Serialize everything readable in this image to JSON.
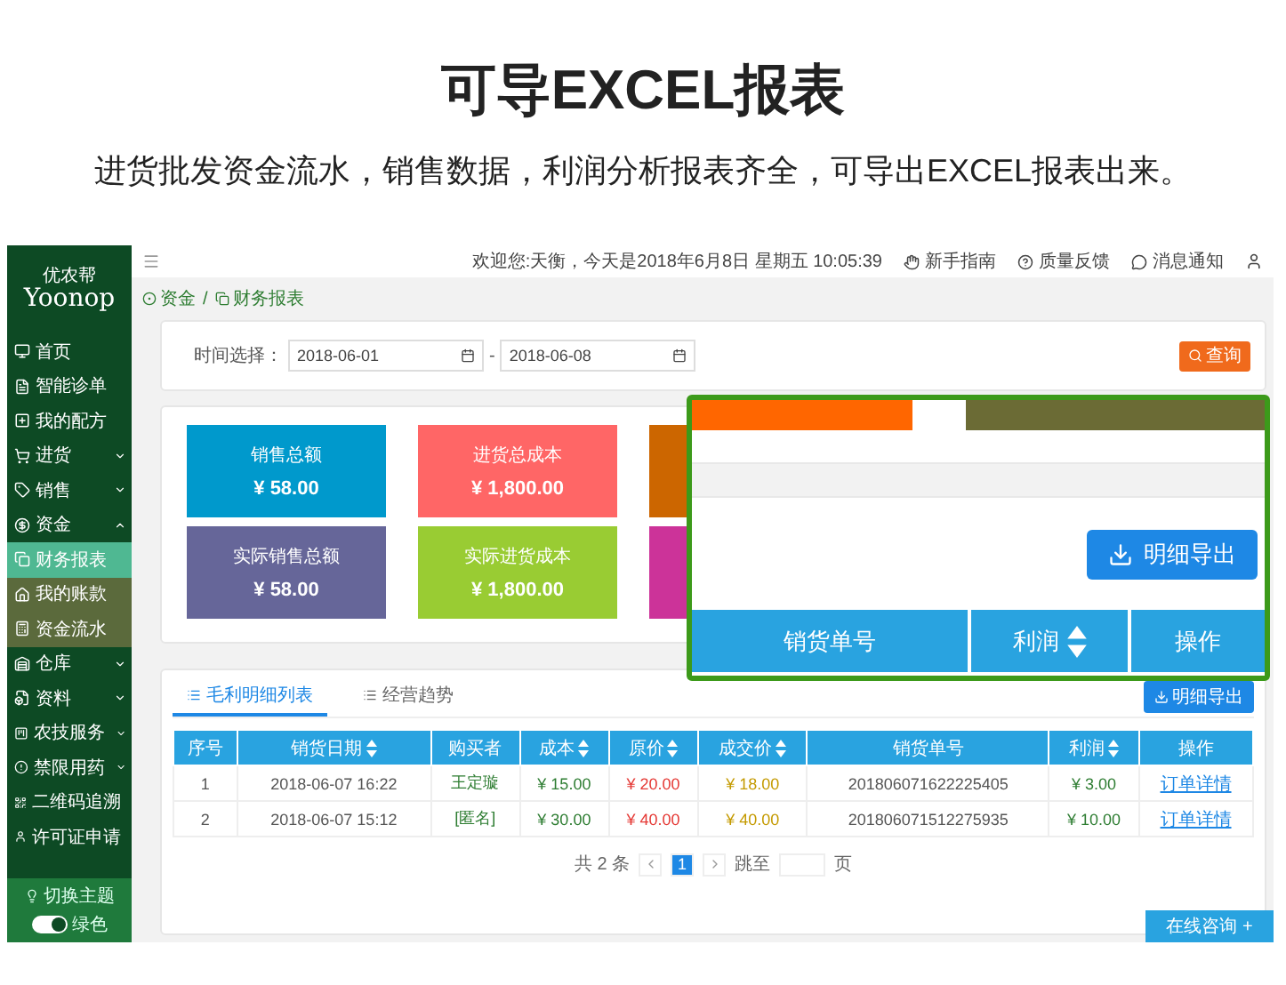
{
  "heading": {
    "title": "可导EXCEL报表",
    "subtitle": "进货批发资金流水，销售数据，利润分析报表齐全，可导出EXCEL报表出来。"
  },
  "app": {
    "logo": {
      "brand_cn": "优农帮",
      "brand": "Yoonop"
    },
    "sidebar": {
      "items": [
        {
          "label": "首页",
          "kind": "link"
        },
        {
          "label": "智能诊单",
          "kind": "link"
        },
        {
          "label": "我的配方",
          "kind": "link"
        },
        {
          "label": "进货",
          "kind": "group",
          "expanded": false
        },
        {
          "label": "销售",
          "kind": "group",
          "expanded": false
        },
        {
          "label": "资金",
          "kind": "group",
          "expanded": true,
          "children": [
            {
              "label": "财务报表",
              "selected": true
            },
            {
              "label": "我的账款",
              "selected": false
            },
            {
              "label": "资金流水",
              "selected": false
            }
          ]
        },
        {
          "label": "仓库",
          "kind": "group",
          "expanded": false
        },
        {
          "label": "资料",
          "kind": "group",
          "expanded": false
        },
        {
          "label": "农技服务",
          "kind": "group",
          "expanded": false
        },
        {
          "label": "禁限用药",
          "kind": "group",
          "expanded": false
        },
        {
          "label": "二维码追溯",
          "kind": "link"
        },
        {
          "label": "许可证申请",
          "kind": "link"
        }
      ]
    },
    "theme_switch": {
      "label": "切换主题",
      "on": true,
      "value": "绿色"
    },
    "topbar": {
      "greeting": "欢迎您:天衡，今天是2018年6月8日 星期五 10:05:39",
      "links": [
        "新手指南",
        "质量反馈",
        "消息通知"
      ]
    },
    "breadcrumb": {
      "items": [
        "资金",
        "财务报表"
      ],
      "separator": "/"
    },
    "filter": {
      "label": "时间选择：",
      "start": "2018-06-01",
      "separator": "-",
      "end": "2018-06-08",
      "button": "查询"
    },
    "summary_cards": [
      {
        "label": "销售总额",
        "value": "¥ 58.00",
        "color": "#0099cc"
      },
      {
        "label": "进货总成本",
        "value": "¥ 1,800.00",
        "color": "#ff6666"
      },
      {
        "color": "#cc6600"
      },
      {
        "label": "实际销售总额",
        "value": "¥ 58.00",
        "color": "#666699"
      },
      {
        "label": "实际进货成本",
        "value": "¥ 1,800.00",
        "color": "#99cc33"
      },
      {
        "color": "#cc3399"
      }
    ],
    "tabs": [
      {
        "label": "毛利明细列表",
        "selected": true
      },
      {
        "label": "经营趋势",
        "selected": false
      }
    ],
    "export_button": "明细导出",
    "table": {
      "columns": [
        {
          "label": "序号",
          "sortable": false,
          "kind": "text"
        },
        {
          "label": "销货日期",
          "sortable": true,
          "kind": "text"
        },
        {
          "label": "购买者",
          "sortable": false,
          "kind": "buyer"
        },
        {
          "label": "成本",
          "sortable": true,
          "kind": "money",
          "color": "#2e7d32"
        },
        {
          "label": "原价",
          "sortable": true,
          "kind": "money",
          "color": "#e53935"
        },
        {
          "label": "成交价",
          "sortable": true,
          "kind": "money",
          "color": "#c49a00"
        },
        {
          "label": "销货单号",
          "sortable": false,
          "kind": "text"
        },
        {
          "label": "利润",
          "sortable": true,
          "kind": "money",
          "color": "#2e7d32"
        },
        {
          "label": "操作",
          "sortable": false,
          "kind": "link"
        }
      ],
      "rows": [
        [
          "1",
          "2018-06-07 16:22",
          "王定璇",
          "¥ 15.00",
          "¥ 20.00",
          "¥ 18.00",
          "201806071622225405",
          "¥ 3.00",
          "订单详情"
        ],
        [
          "2",
          "2018-06-07 15:12",
          "[匿名]",
          "¥ 30.00",
          "¥ 40.00",
          "¥ 40.00",
          "201806071512275935",
          "¥ 10.00",
          "订单详情"
        ]
      ]
    },
    "pagination": {
      "total": "共 2 条",
      "pages": [
        {
          "label": "1",
          "selected": true
        }
      ],
      "jump_label": "跳至",
      "page_unit": "页"
    },
    "chat_button": "在线咨询 +"
  },
  "zoom_callout": {
    "export_button": "明细导出",
    "columns": [
      {
        "label": "销货单号",
        "sortable": false
      },
      {
        "label": "利润",
        "sortable": true
      },
      {
        "label": "操作",
        "sortable": false
      }
    ]
  }
}
